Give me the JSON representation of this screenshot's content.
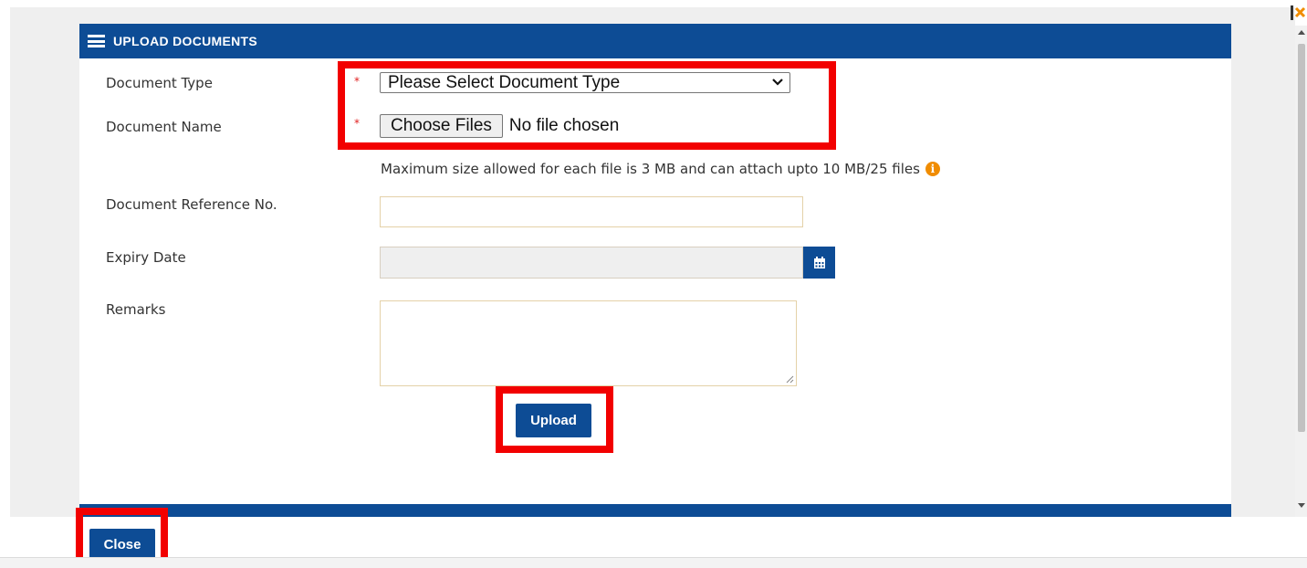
{
  "dialog": {
    "title": "UPLOAD DOCUMENTS",
    "icons": {
      "header": "menu-lines-icon",
      "corner": "close-x-icon",
      "info": "info-icon",
      "calendar": "calendar-icon"
    },
    "colors": {
      "header_bg": "#0d4c95",
      "required_marker": "#e02020",
      "highlight": "#f20000",
      "info_icon": "#f08c00"
    }
  },
  "form": {
    "document_type": {
      "label": "Document Type",
      "required_mark": "*",
      "selected": "Please Select Document Type"
    },
    "document_name": {
      "label": "Document Name",
      "required_mark": "*",
      "button_label": "Choose Files",
      "status": "No file chosen"
    },
    "hint": "Maximum size allowed for each file is 3 MB and can attach upto 10 MB/25 files",
    "info_glyph": "i",
    "reference_no": {
      "label": "Document Reference No.",
      "value": ""
    },
    "expiry_date": {
      "label": "Expiry Date",
      "value": ""
    },
    "remarks": {
      "label": "Remarks",
      "value": ""
    }
  },
  "buttons": {
    "upload": "Upload",
    "close": "Close"
  }
}
